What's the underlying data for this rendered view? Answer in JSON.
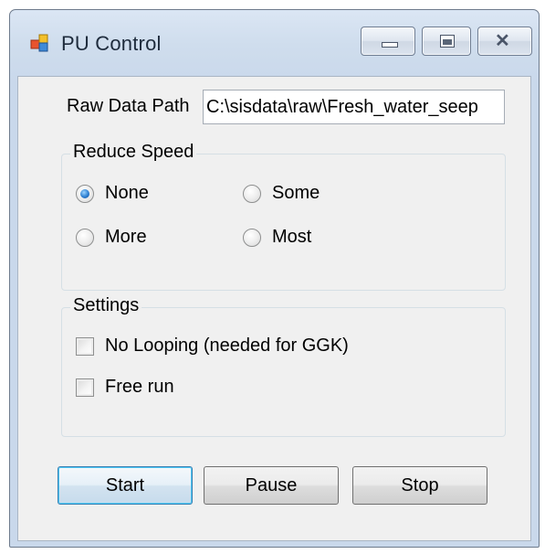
{
  "window": {
    "title": "PU Control"
  },
  "caption_buttons": {
    "minimize_icon": "minimize-icon",
    "maximize_icon": "maximize-icon",
    "close_icon": "close-icon",
    "close_glyph": "✕"
  },
  "raw_data_path": {
    "label": "Raw Data Path",
    "value": "C:\\sisdata\\raw\\Fresh_water_seep"
  },
  "reduce_speed": {
    "title": "Reduce Speed",
    "options": [
      {
        "label": "None",
        "checked": true
      },
      {
        "label": "Some",
        "checked": false
      },
      {
        "label": "More",
        "checked": false
      },
      {
        "label": "Most",
        "checked": false
      }
    ]
  },
  "settings": {
    "title": "Settings",
    "checkboxes": [
      {
        "label": "No Looping (needed for GGK)",
        "checked": false
      },
      {
        "label": "Free run",
        "checked": false
      }
    ]
  },
  "buttons": {
    "start": "Start",
    "pause": "Pause",
    "stop": "Stop"
  },
  "colors": {
    "radio_selected": "#2d7fd1",
    "focused_button_border": "#3c7fb1"
  }
}
